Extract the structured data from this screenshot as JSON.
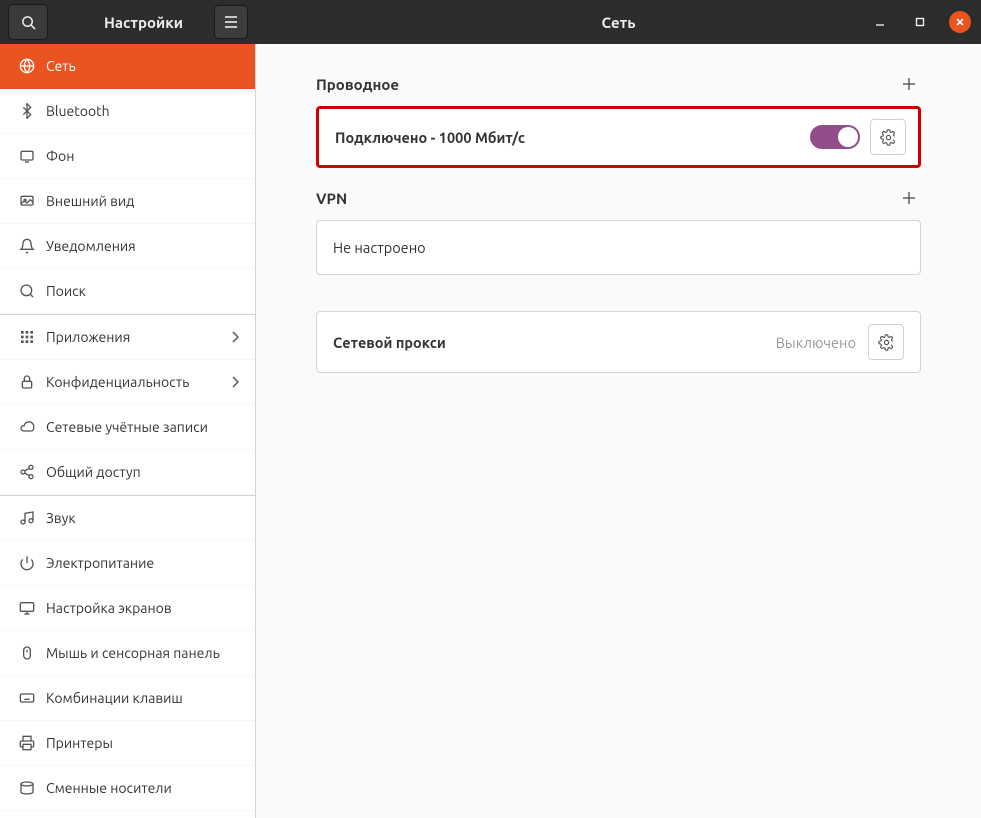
{
  "titlebar": {
    "sidebar_title": "Настройки",
    "main_title": "Сеть"
  },
  "sidebar": {
    "items": [
      {
        "label": "Сеть",
        "icon": "globe",
        "active": true
      },
      {
        "label": "Bluetooth",
        "icon": "bluetooth"
      },
      {
        "label": "Фон",
        "icon": "background"
      },
      {
        "label": "Внешний вид",
        "icon": "appearance"
      },
      {
        "label": "Уведомления",
        "icon": "bell"
      },
      {
        "label": "Поиск",
        "icon": "search"
      },
      {
        "label": "Приложения",
        "icon": "apps",
        "chevron": true,
        "sep_before": true
      },
      {
        "label": "Конфиденциальность",
        "icon": "lock",
        "chevron": true
      },
      {
        "label": "Сетевые учётные записи",
        "icon": "cloud"
      },
      {
        "label": "Общий доступ",
        "icon": "share"
      },
      {
        "label": "Звук",
        "icon": "sound",
        "sep_before": true
      },
      {
        "label": "Электропитание",
        "icon": "power"
      },
      {
        "label": "Настройка экранов",
        "icon": "displays"
      },
      {
        "label": "Мышь и сенсорная панель",
        "icon": "mouse"
      },
      {
        "label": "Комбинации клавиш",
        "icon": "keyboard"
      },
      {
        "label": "Принтеры",
        "icon": "printer"
      },
      {
        "label": "Сменные носители",
        "icon": "removable"
      }
    ]
  },
  "main": {
    "wired": {
      "title": "Проводное",
      "status": "Подключено - 1000 Мбит/с",
      "toggle_on": true
    },
    "vpn": {
      "title": "VPN",
      "status": "Не настроено"
    },
    "proxy": {
      "title": "Сетевой прокси",
      "status": "Выключено"
    }
  },
  "colors": {
    "accent": "#e95420",
    "toggle": "#924d8b",
    "highlight": "#d40000"
  }
}
